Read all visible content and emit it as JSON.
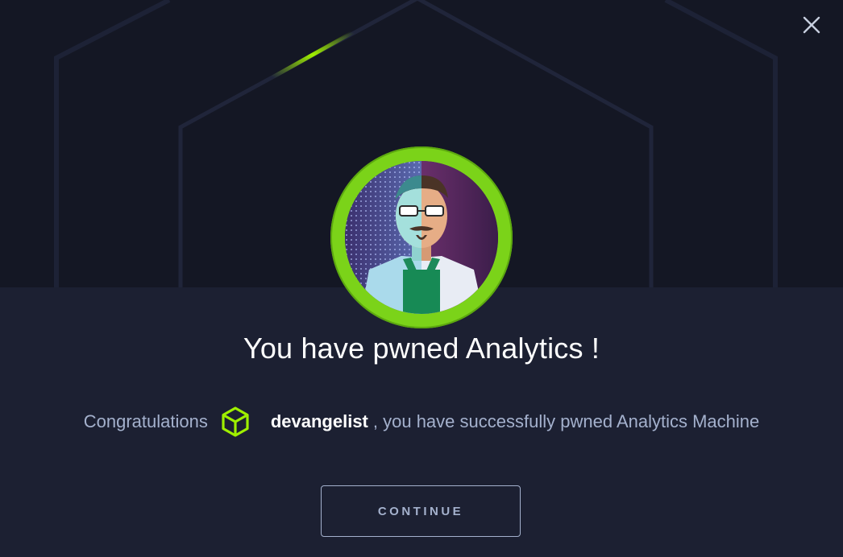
{
  "modal": {
    "title": "You have pwned Analytics !",
    "congrats_prefix": "Congratulations",
    "username": "devangelist",
    "congrats_suffix": ", you have successfully pwned Analytics Machine",
    "continue_label": "CONTINUE",
    "icons": {
      "close": "close-icon",
      "user_rank": "cube-icon",
      "avatar": "machine-avatar"
    }
  },
  "colors": {
    "accent": "#9fef00",
    "ring": "#7bd319",
    "text_muted": "#a4b1cd",
    "text_primary": "#ffffff",
    "background_top": "#141724",
    "background_bottom": "#1c2032"
  }
}
